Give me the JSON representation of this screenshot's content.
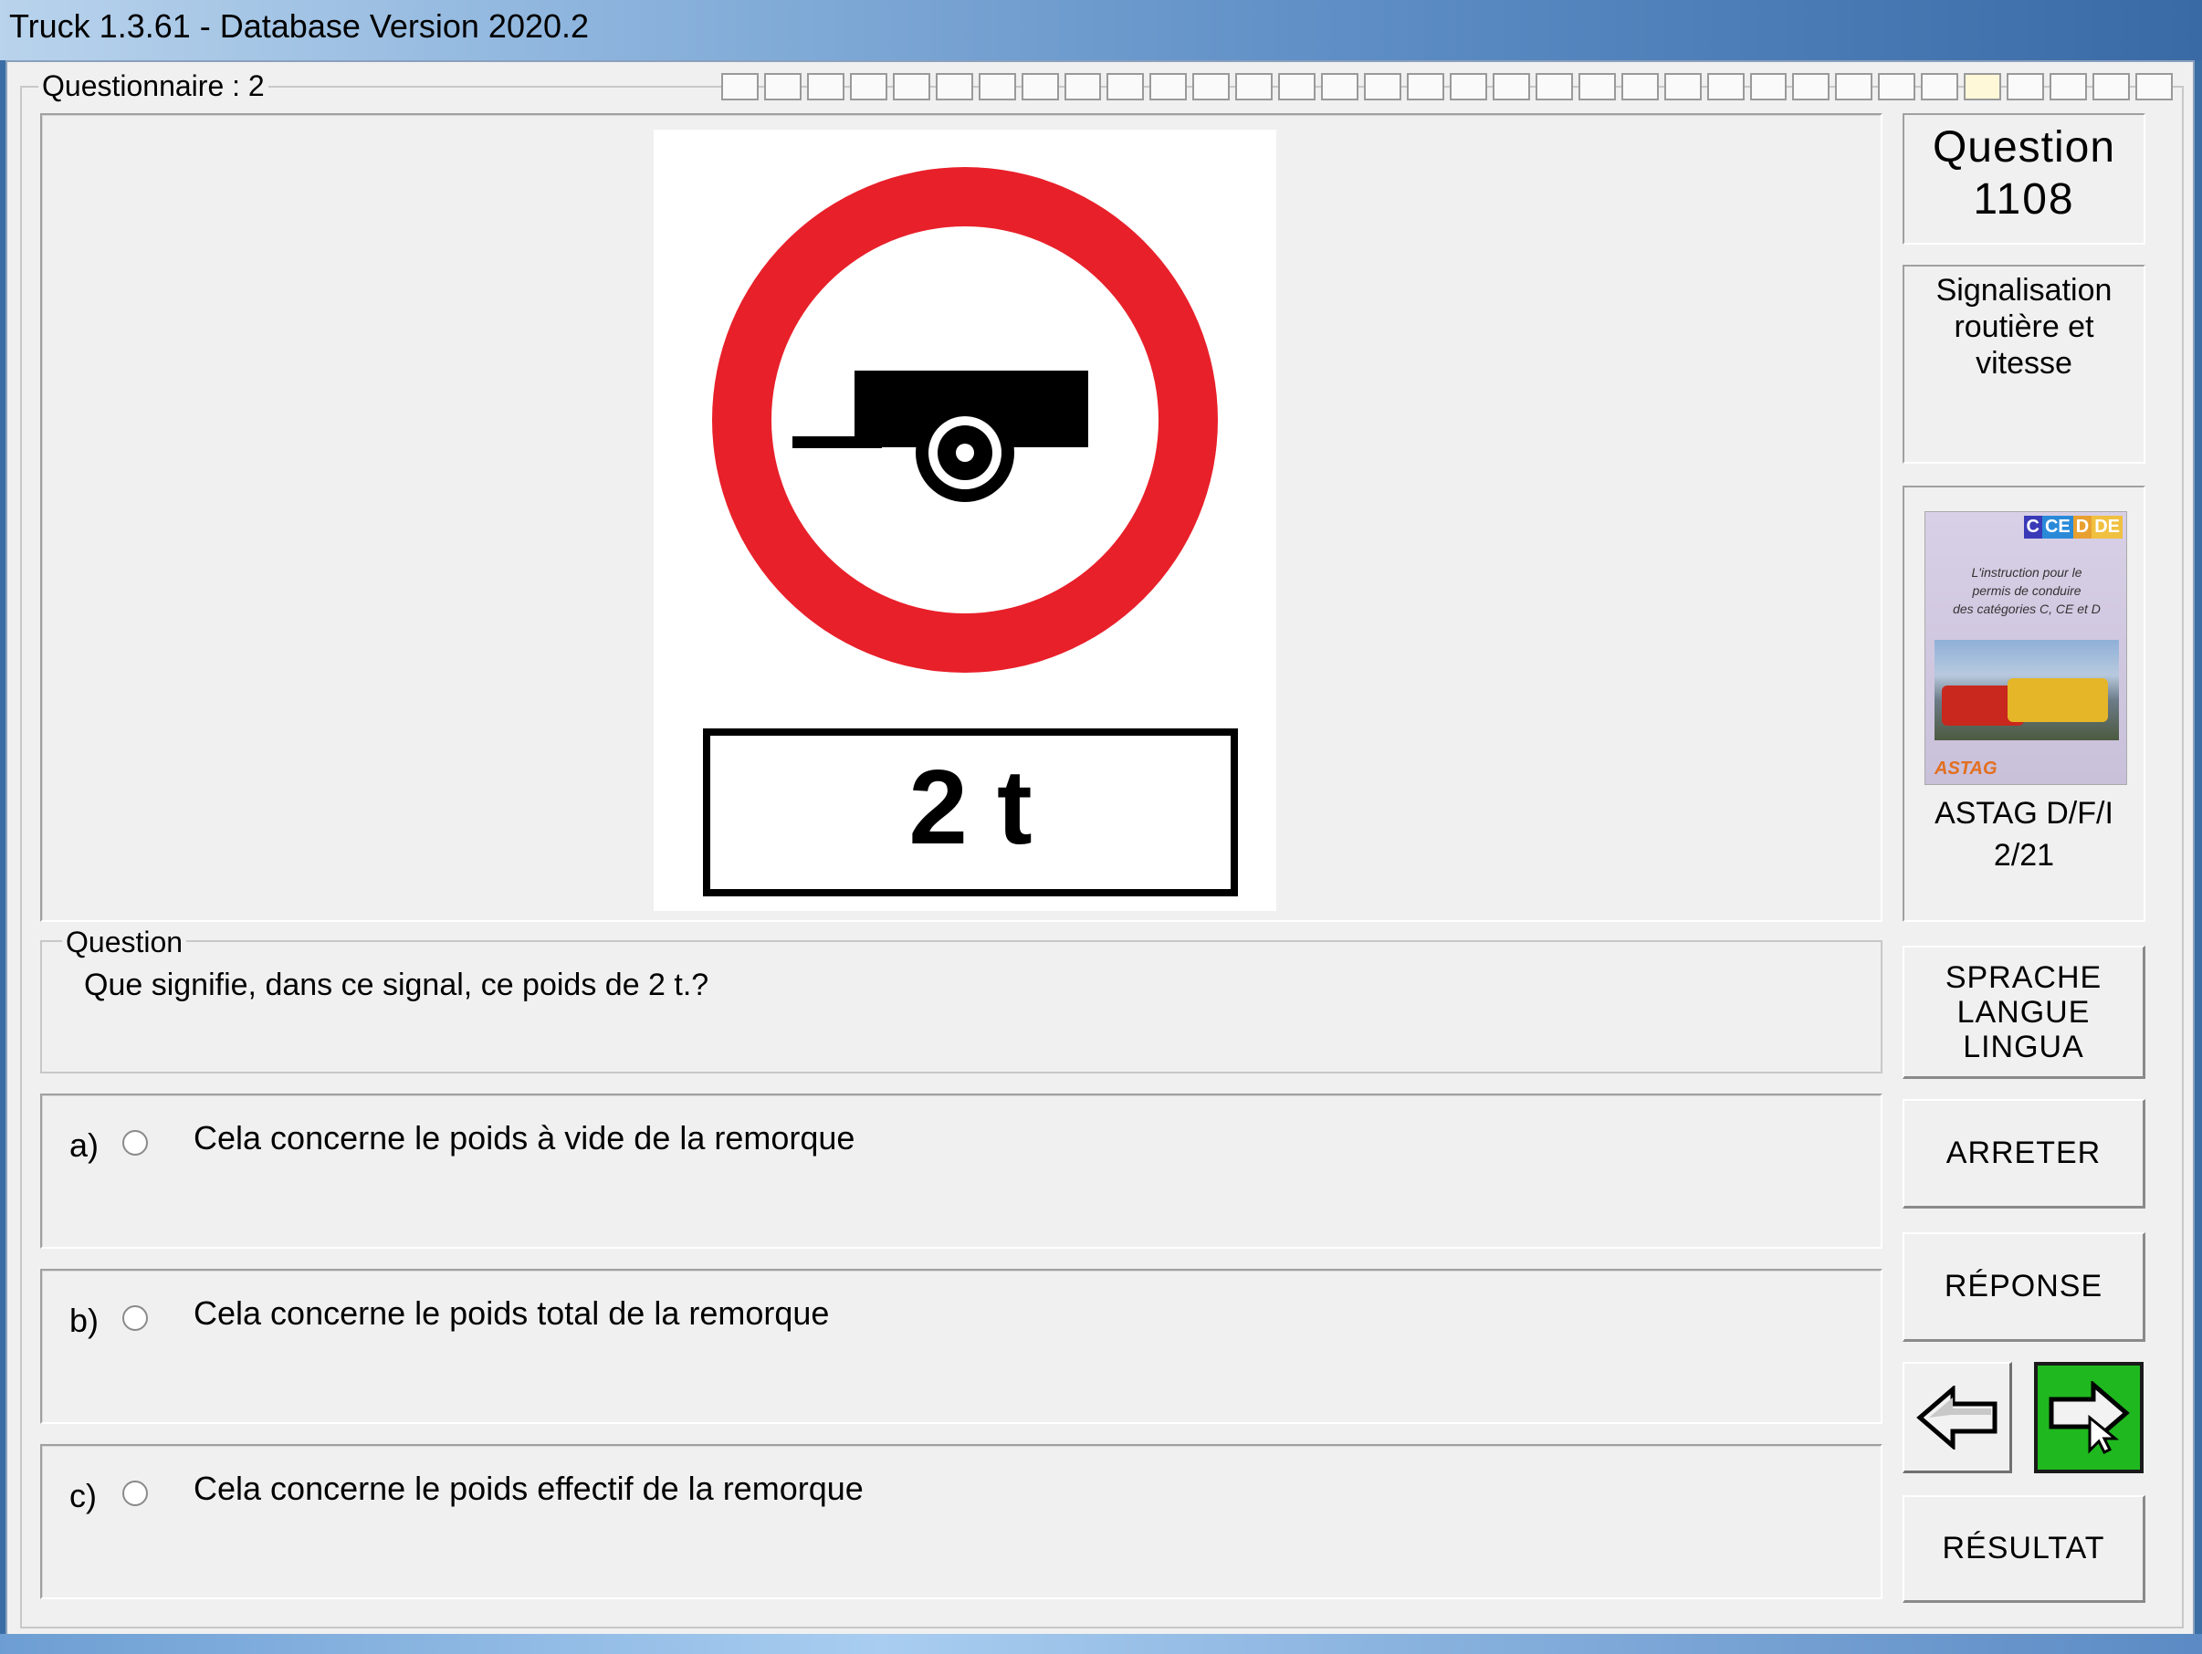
{
  "window": {
    "title": "Truck 1.3.61 - Database Version 2020.2"
  },
  "questionnaire": {
    "label": "Questionnaire : 2",
    "progress_cells": 34,
    "current_cell": 29
  },
  "sign": {
    "type": "no-trailers-sign",
    "plate_text": "2 t",
    "ring_color": "#e8202a"
  },
  "question": {
    "group_label": "Question",
    "text": "Que signifie, dans ce signal, ce poids de 2 t.?"
  },
  "answers": [
    {
      "letter": "a)",
      "text": "Cela concerne le poids à vide de la remorque"
    },
    {
      "letter": "b)",
      "text": "Cela concerne le poids total de la remorque"
    },
    {
      "letter": "c)",
      "text": "Cela concerne le poids effectif de la remorque"
    }
  ],
  "sidebar": {
    "question_label": "Question",
    "question_number": "1108",
    "category_line1": "Signalisation",
    "category_line2": "routière et vitesse",
    "book": {
      "tags": [
        "C",
        "CE",
        "D",
        "DE"
      ],
      "cover_lines": [
        "L'instruction pour le",
        "permis de conduire",
        "des catégories C, CE et D"
      ],
      "publisher": "ASTAG",
      "title_line1": "ASTAG D/F/I",
      "title_line2": "2/21"
    },
    "language_lines": [
      "SPRACHE",
      "LANGUE",
      "LINGUA"
    ],
    "stop_label": "ARRETER",
    "answer_label": "RÉPONSE",
    "result_label": "RÉSULTAT",
    "prev_icon": "arrow-left-icon",
    "next_icon": "arrow-right-icon",
    "next_color": "#1fb81f"
  }
}
